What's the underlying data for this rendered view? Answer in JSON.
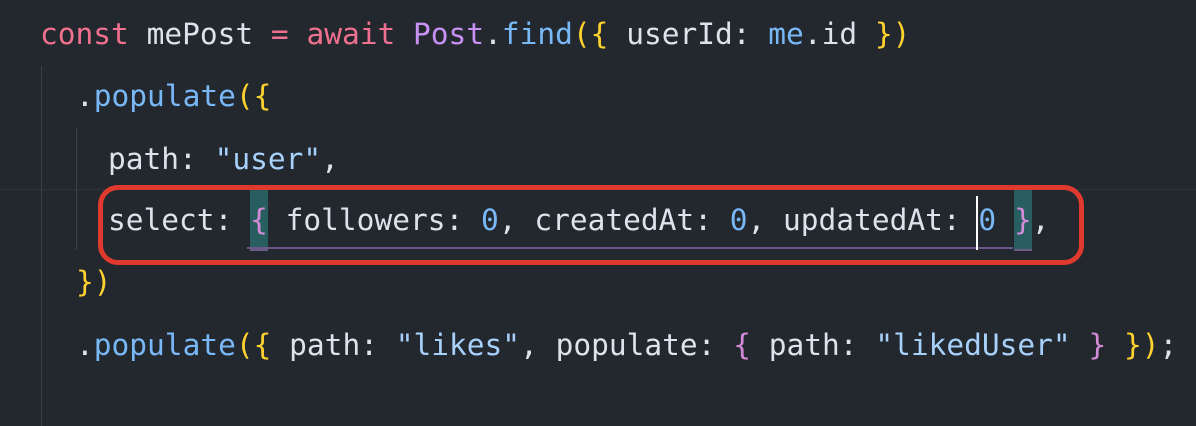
{
  "editor": {
    "theme": {
      "background": "#23272e",
      "keyword": "#f0708f",
      "class": "#c891f5",
      "function": "#79b8f7",
      "number": "#79b8f7",
      "string": "#a7d0fb",
      "bracket_level1": "#ffd22e",
      "bracket_level2": "#d38bd7",
      "highlight_box": "#e03a2e"
    },
    "lines": [
      {
        "tokens": [
          "const",
          " ",
          "mePost",
          " ",
          "=",
          " ",
          "await",
          " ",
          "Post",
          ".",
          "find",
          "(",
          "{",
          " ",
          "userId",
          ":",
          " ",
          "me",
          ".",
          "id",
          " ",
          "}",
          ")"
        ]
      },
      {
        "tokens": [
          ".",
          "populate",
          "(",
          "{"
        ]
      },
      {
        "tokens": [
          "path",
          ":",
          " ",
          "\"user\"",
          ","
        ]
      },
      {
        "tokens": [
          "select",
          ":",
          " ",
          "{",
          " ",
          "followers",
          ":",
          " ",
          "0",
          ",",
          " ",
          "createdAt",
          ":",
          " ",
          "0",
          ",",
          " ",
          "updatedAt",
          ":",
          " ",
          "0",
          " ",
          "}",
          ","
        ]
      },
      {
        "tokens": [
          "}",
          ")"
        ]
      },
      {
        "tokens": [
          ".",
          "populate",
          "(",
          "{",
          " ",
          "path",
          ":",
          " ",
          "\"likes\"",
          ",",
          " ",
          "populate",
          ":",
          " ",
          "{",
          " ",
          "path",
          ":",
          " ",
          "\"likedUser\"",
          " ",
          "}",
          " ",
          "}",
          ")",
          ";"
        ]
      }
    ]
  }
}
